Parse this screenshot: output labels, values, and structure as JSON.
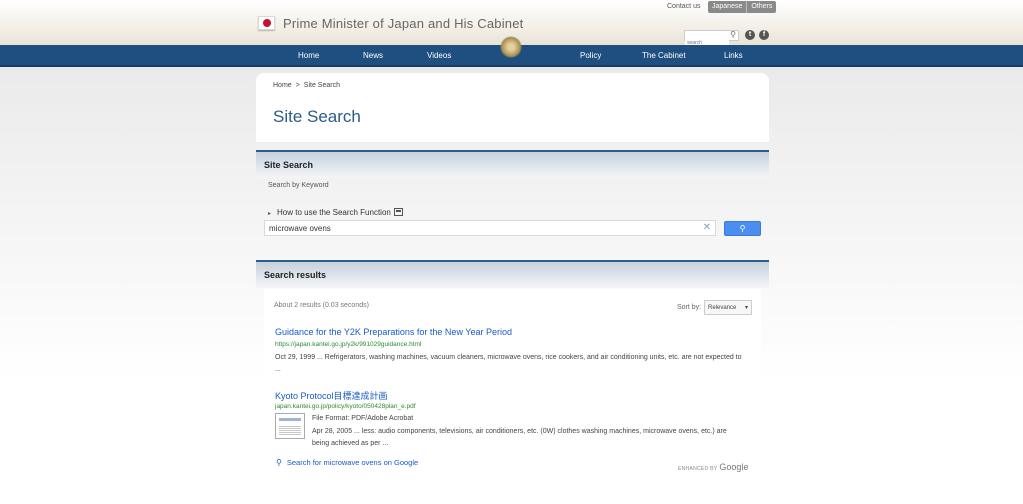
{
  "header": {
    "site_title": "Prime Minister of Japan and His Cabinet",
    "contact": "Contact us",
    "lang_japanese": "Japanese",
    "lang_other": "Others",
    "search_placeholder": "search",
    "social": [
      "twitter-icon",
      "facebook-icon"
    ]
  },
  "nav": {
    "items": [
      "Home",
      "News",
      "Videos",
      "Policy",
      "The Cabinet",
      "Links"
    ]
  },
  "breadcrumb": {
    "home": "Home",
    "separator": ">",
    "current": "Site Search"
  },
  "page_title": "Site Search",
  "search_panel": {
    "heading": "Site Search",
    "keyword_label": "Search by Keyword",
    "howto_link": "How to use the Search Function",
    "query": "microwave ovens",
    "clear_symbol": "✕",
    "search_button_icon": "search-icon"
  },
  "results_panel": {
    "heading": "Search results",
    "count_text": "About 2 results (0.03 seconds)",
    "sort_label": "Sort by:",
    "sort_value": "Relevance",
    "results": [
      {
        "title": "Guidance for the Y2K Preparations for the New Year Period",
        "url": "https://japan.kantei.go.jp/y2k/991029guidance.html",
        "snippet": "Oct 29, 1999 ... Refrigerators, washing machines, vacuum cleaners, microwave ovens, rice cookers, and air conditioning units, etc. are not expected to ..."
      },
      {
        "title": "Kyoto Protocol目標達成計画",
        "url": "japan.kantei.go.jp/policy/kyoto/050428plan_e.pdf",
        "file_format": "File Format: PDF/Adobe Acrobat",
        "snippet": "Apr 28, 2005 ... less: audio components, televisions, air conditioners, etc. (0W) clothes washing machines, microwave ovens, etc.) are being achieved as per ..."
      }
    ],
    "google_link": "Search for microwave ovens on Google",
    "enhanced_by": "ENHANCED BY",
    "google": "Google"
  }
}
